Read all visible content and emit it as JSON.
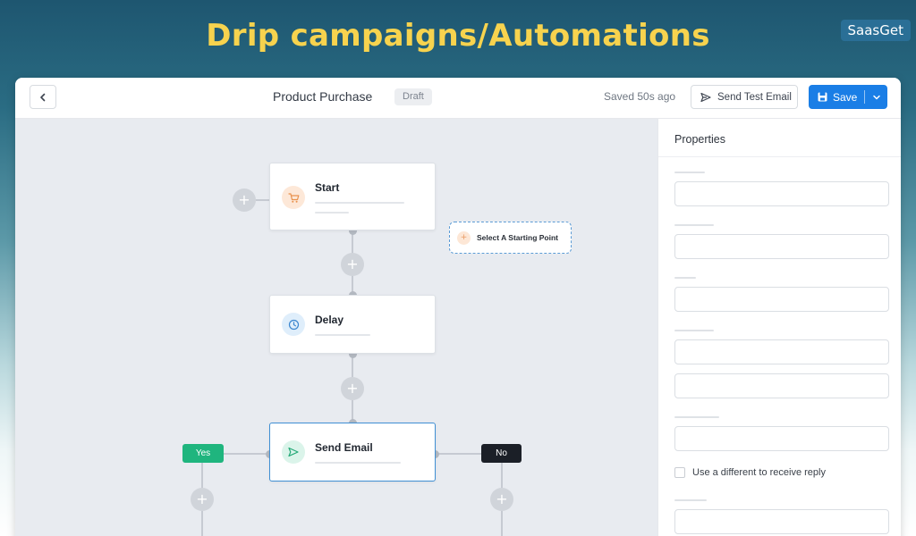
{
  "banner": {
    "title": "Drip campaigns/Automations",
    "brand": "SaasGet"
  },
  "header": {
    "title": "Product Purchase",
    "status": "Draft",
    "saved_text": "Saved 50s ago",
    "send_test_label": "Send Test Email",
    "save_label": "Save"
  },
  "flow": {
    "start_label": "Start",
    "delay_label": "Delay",
    "send_email_label": "Send Email",
    "starting_point_label": "Select A Starting Point",
    "branch_yes": "Yes",
    "branch_no": "No"
  },
  "properties": {
    "title": "Properties",
    "checkbox_label": "Use a different to receive reply",
    "checkbox_checked": false
  },
  "colors": {
    "banner_title": "#f7d34e",
    "brand_bg": "#2a6f96",
    "primary": "#1a7ee6",
    "active_border": "#3f8fd4",
    "yes_green": "#1fb57e",
    "no_dark": "#1b1f27",
    "canvas_bg": "#e8ebf0"
  },
  "icons": {
    "back": "chevron-left-icon",
    "send_test": "paper-plane-icon",
    "save": "floppy-disk-icon",
    "save_menu": "chevron-down-icon",
    "start_node": "cart-icon",
    "delay_node": "clock-icon",
    "send_email_node": "paper-plane-icon",
    "add_step": "plus-icon"
  }
}
